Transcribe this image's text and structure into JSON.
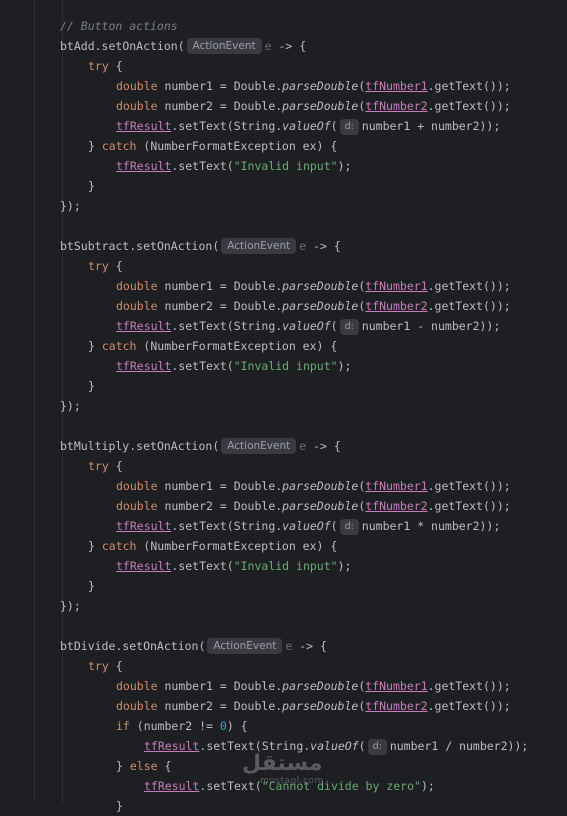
{
  "editor": {
    "comment": "// Button actions",
    "hints": {
      "event_type": "ActionEvent",
      "param_hint": "d:",
      "ghost_suffix": "e"
    },
    "tokens": {
      "try": "try",
      "catch": "catch",
      "if": "if",
      "else": "else",
      "double": "double",
      "exception": "(NumberFormatException ex) {",
      "invalid": "\"Invalid input\"",
      "divzero": "\"Cannot divide by zero\"",
      "zero": "0",
      "tfNumber1": "tfNumber1",
      "tfNumber2": "tfNumber2",
      "tfResult": "tfResult",
      "parseDouble": "parseDouble",
      "valueOf": "valueOf"
    },
    "blocks": [
      {
        "button": "btAdd",
        "op_expr": "number1 + number2));"
      },
      {
        "button": "btSubtract",
        "op_expr": "number1 - number2));"
      },
      {
        "button": "btMultiply",
        "op_expr": "number1 * number2));"
      },
      {
        "button": "btDivide",
        "op_expr": "number1 / number2));"
      }
    ]
  },
  "watermark": {
    "arabic": "مستقل",
    "latin": "mostaql.com"
  }
}
